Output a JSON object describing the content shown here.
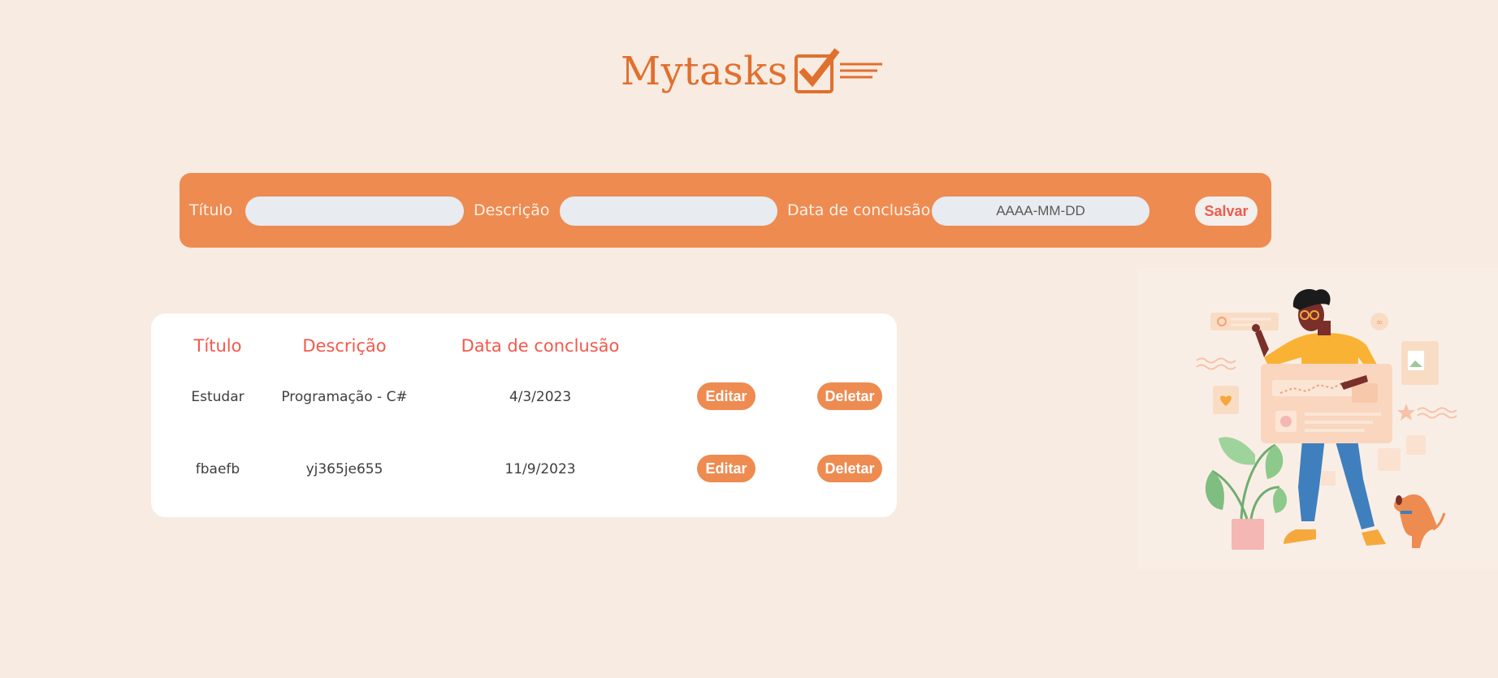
{
  "app": {
    "title": "Mytasks",
    "logo_icon": "task-checklist-icon"
  },
  "form": {
    "title_label": "Título",
    "title_value": "",
    "description_label": "Descrição",
    "description_value": "",
    "date_label": "Data de conclusão",
    "date_placeholder": "AAAA-MM-DD",
    "save_label": "Salvar"
  },
  "table": {
    "headers": {
      "title": "Título",
      "description": "Descrição",
      "date": "Data de conclusão"
    },
    "rows": [
      {
        "title": "Estudar",
        "description": "Programação - C#",
        "date": "4/3/2023",
        "edit_label": "Editar",
        "delete_label": "Deletar"
      },
      {
        "title": "fbaefb",
        "description": "yj365je655",
        "date": "11/9/2023",
        "edit_label": "Editar",
        "delete_label": "Deletar"
      }
    ]
  },
  "illustration": {
    "subject": "person-with-task-board-plant-and-dog"
  },
  "colors": {
    "background": "#f8ebe1",
    "accent": "#ee8b51",
    "header_text": "#f2594b",
    "logo": "#e0702e",
    "input_bg": "#e8ebf0",
    "card": "#ffffff"
  }
}
